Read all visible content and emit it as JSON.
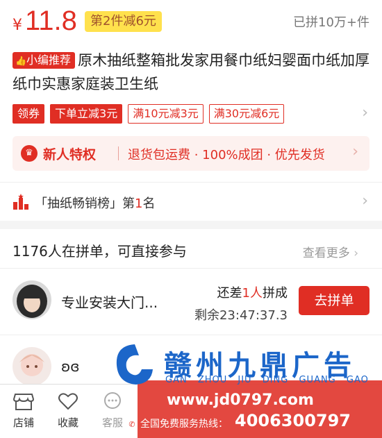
{
  "price": {
    "currency": "¥",
    "value": "11.8",
    "promo": "第2件减6元",
    "sold": "已拼10万+件"
  },
  "product": {
    "editor_tag": "小编推荐",
    "title": "原木抽纸整箱批发家用餐巾纸妇婴面巾纸加厚纸巾实惠家庭装卫生纸"
  },
  "coupons": [
    "领券",
    "下单立减3元",
    "满10元减3元",
    "满30元减6元"
  ],
  "new_user": {
    "title": "新人特权",
    "desc": "退货包运费 · 100%成团 · 优先发货"
  },
  "ranking": {
    "prefix": "「抽纸畅销榜」第",
    "rank": "1",
    "suffix": "名"
  },
  "group_buy": {
    "header": "1176人在拼单，可直接参与",
    "more": "查看更多",
    "items": [
      {
        "name": "专业安装大门...",
        "need_prefix": "还差",
        "need_count": "1人",
        "need_suffix": "拼成",
        "remain": "剩余23:47:37.3",
        "button": "去拼单"
      },
      {
        "name": "ʚɞ"
      }
    ]
  },
  "bottom_bar": {
    "store": "店铺",
    "favorite": "收藏",
    "service": "客服"
  },
  "watermark": {
    "name_cn": "赣州九鼎广告",
    "name_py": "GAN ZHOU JIU DING GUANG GAO",
    "url": "www.jd0797.com",
    "hotline_label": "全国免费服务热线：",
    "hotline": "4006300797"
  },
  "colors": {
    "accent": "#e02e24",
    "promo_bg": "#ffe14d",
    "brand_blue": "#1c66c9"
  }
}
